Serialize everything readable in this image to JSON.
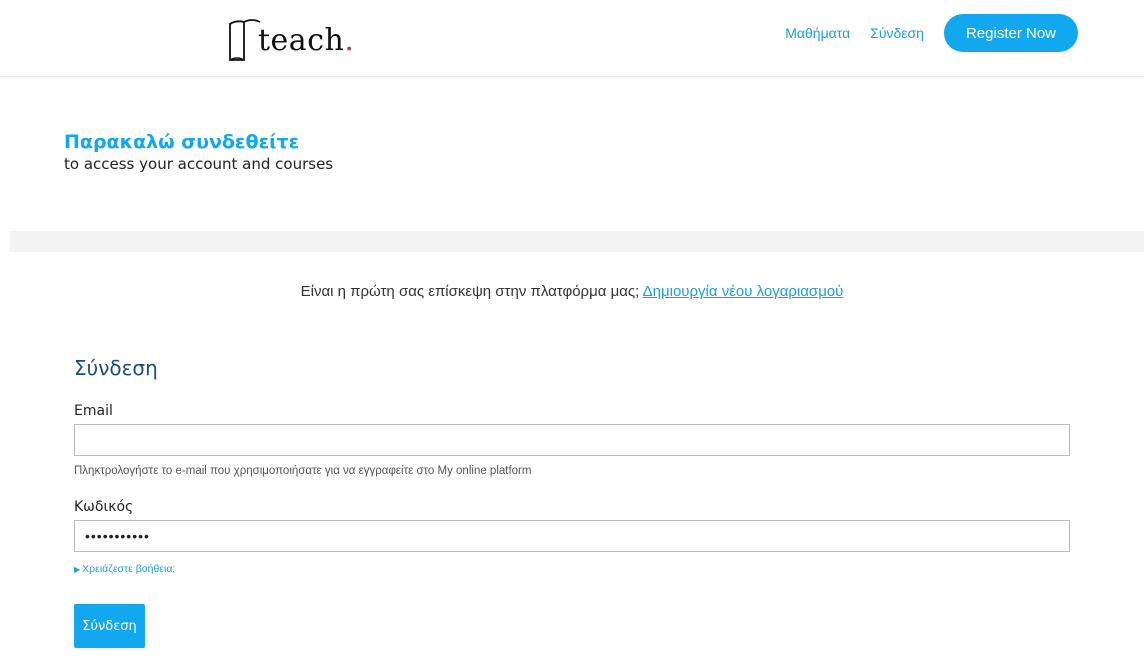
{
  "brand": {
    "logo_text": "teach",
    "logo_dot": "."
  },
  "nav": {
    "courses_label": "Μαθήματα",
    "login_label": "Σύνδεση",
    "register_label": "Register Now"
  },
  "hero": {
    "title": "Παρακαλώ συνδεθείτε",
    "subtitle": "to access your account and courses"
  },
  "first_visit": {
    "text": "Είναι η πρώτη σας επίσκεψη στην πλατφόρμα μας;",
    "link_label": "Δημιουργία νέου λογαριασμού"
  },
  "login_form": {
    "title": "Σύνδεση",
    "email_label": "Email",
    "email_value": "",
    "email_help": "Πληκτρολογήστε το e-mail που χρησιμοποιήσατε για να εγγραφείτε στο My online platform",
    "password_label": "Κωδικός",
    "password_value": "•••••••••••",
    "help_link_label": "Χρειάζεστε βοήθεια;",
    "submit_label": "Σύνδεση"
  },
  "colors": {
    "accent": "#12a8f0",
    "link": "#1a9fd8",
    "heading": "#1a4f7a"
  }
}
